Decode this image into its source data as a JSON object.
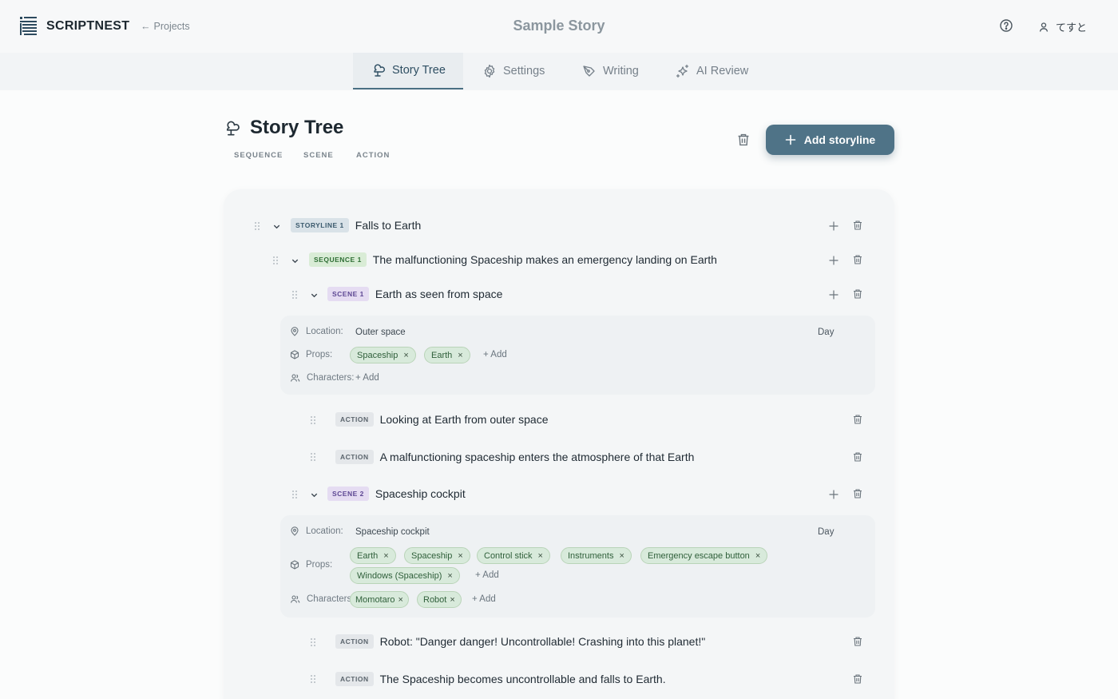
{
  "header": {
    "brand": "SCRIPTNEST",
    "back_label": "Projects",
    "project_title": "Sample Story",
    "user_name": "てすと"
  },
  "tabs": [
    {
      "label": "Story Tree",
      "icon": "tree-icon",
      "active": true
    },
    {
      "label": "Settings",
      "icon": "gear-icon",
      "active": false
    },
    {
      "label": "Writing",
      "icon": "pen-icon",
      "active": false
    },
    {
      "label": "AI Review",
      "icon": "sparkle-icon",
      "active": false
    }
  ],
  "page": {
    "title": "Story Tree",
    "legend": [
      "SEQUENCE",
      "SCENE",
      "ACTION"
    ],
    "add_storyline_label": "Add storyline"
  },
  "tree": {
    "storyline": {
      "badge": "STORYLINE 1",
      "title": "Falls to Earth"
    },
    "sequence": {
      "badge": "SEQUENCE 1",
      "title": "The malfunctioning Spaceship makes an emergency landing on Earth"
    },
    "scene1": {
      "badge": "SCENE 1",
      "title": "Earth as seen from space",
      "location_label": "Location:",
      "location": "Outer space",
      "time": "Day",
      "props_label": "Props:",
      "props": [
        "Spaceship",
        "Earth"
      ],
      "characters_label": "Characters:",
      "characters": [],
      "add_label": "+ Add",
      "actions": [
        {
          "badge": "ACTION",
          "text": "Looking at Earth from outer space"
        },
        {
          "badge": "ACTION",
          "text": "A malfunctioning spaceship enters the atmosphere of that Earth"
        }
      ]
    },
    "scene2": {
      "badge": "SCENE 2",
      "title": "Spaceship cockpit",
      "location_label": "Location:",
      "location": "Spaceship cockpit",
      "time": "Day",
      "props_label": "Props:",
      "props": [
        "Earth",
        "Spaceship",
        "Control stick",
        "Instruments",
        "Emergency escape button",
        "Windows (Spaceship)"
      ],
      "characters_label": "Characters:",
      "characters": [
        "Momotaro",
        "Robot"
      ],
      "add_label": "+ Add",
      "actions": [
        {
          "badge": "ACTION",
          "text": "Robot: \"Danger danger! Uncontrollable! Crashing into this planet!\""
        },
        {
          "badge": "ACTION",
          "text": "The Spaceship becomes uncontrollable and falls to Earth."
        }
      ]
    }
  },
  "colors": {
    "accent": "#4f7387",
    "sequence_badge": "#d9ecd6",
    "scene_badge": "#e5dcf2",
    "chip": "#d8eadb"
  }
}
